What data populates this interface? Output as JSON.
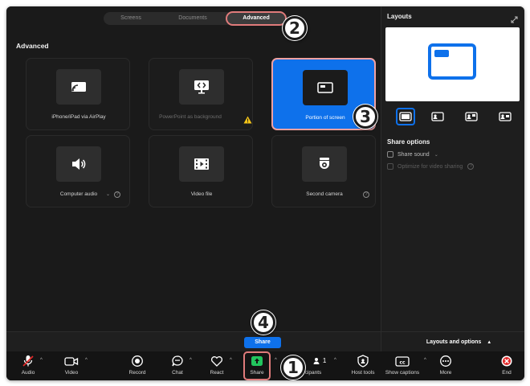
{
  "tabs": [
    "Screens",
    "Documents",
    "Advanced"
  ],
  "section_title": "Advanced",
  "cards": [
    {
      "label": "iPhone/iPad via AirPlay",
      "icon": "airplay-icon"
    },
    {
      "label": "PowerPoint as background",
      "icon": "powerpoint-icon",
      "badge": "warning-icon"
    },
    {
      "label": "Portion of screen",
      "icon": "portion-screen-icon",
      "selected": true
    },
    {
      "label": "Computer audio",
      "icon": "speaker-icon"
    },
    {
      "label": "Video file",
      "icon": "film-icon"
    },
    {
      "label": "Second camera",
      "icon": "camera-icon"
    }
  ],
  "share_button": "Share",
  "right_panel": {
    "title": "Layouts",
    "share_options_title": "Share options",
    "share_sound": "Share sound",
    "optimize_video": "Optimize for video sharing",
    "footer": "Layouts and options"
  },
  "toolbar": {
    "audio": "Audio",
    "video": "Video",
    "record": "Record",
    "chat": "Chat",
    "react": "React",
    "share": "Share",
    "participants": "cipants",
    "participants_count": "1",
    "host_tools": "Host tools",
    "show_captions": "Show captions",
    "more": "More",
    "end": "End"
  },
  "steps": [
    "1",
    "2",
    "3",
    "4"
  ],
  "colors": {
    "accent": "#0e71eb",
    "highlight": "#e07b7b",
    "end": "#e02828",
    "share_green": "#22c55e"
  }
}
